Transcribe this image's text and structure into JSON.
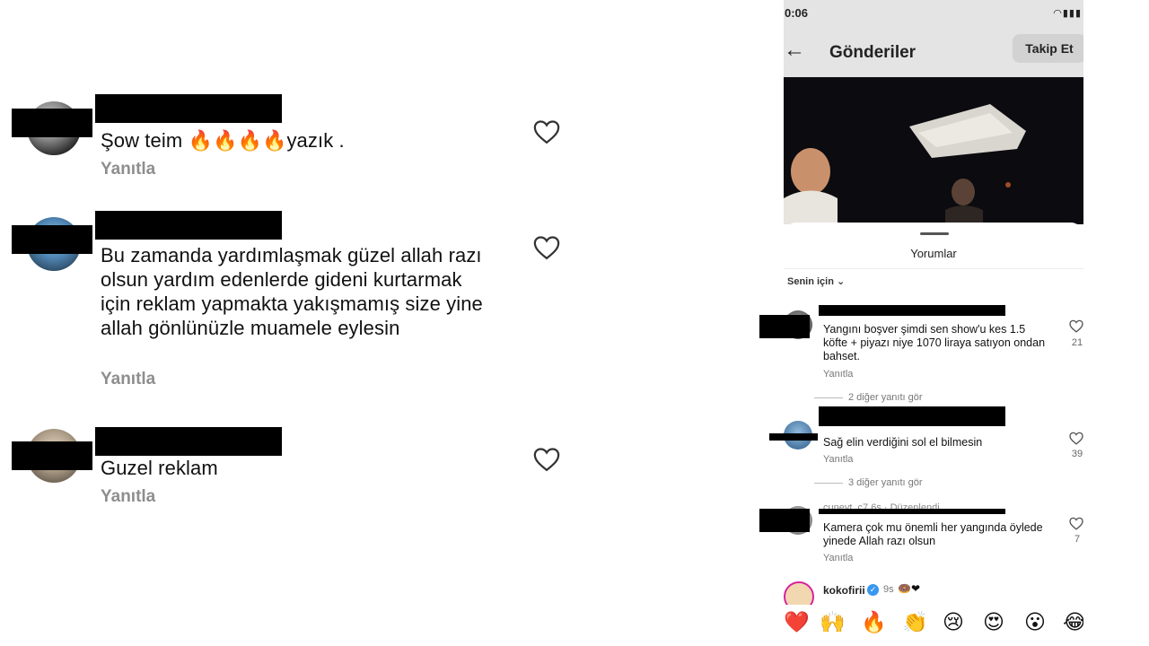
{
  "left_comments": [
    {
      "text": "Şow teim 🔥🔥🔥🔥yazık .",
      "reply": "Yanıtla"
    },
    {
      "text": "Bu zamanda yardımlaşmak güzel allah razı olsun yardım edenlerde gideni kurtarmak için reklam yapmakta yakışmamış size yine allah gönlünüzle muamele eylesin",
      "reply": "Yanıtla"
    },
    {
      "text": "Guzel reklam",
      "reply": "Yanıtla"
    }
  ],
  "phone": {
    "status_time": "0:06",
    "header": {
      "title": "Gönderiler",
      "follow_button": "Takip Et"
    },
    "sheet_title": "Yorumlar",
    "filter_label": "Senin için",
    "comments": [
      {
        "name_partial": "",
        "text": "Yangını boşver şimdi sen show'u kes 1.5 köfte + piyazı niye 1070 liraya satıyon ondan  bahset.",
        "reply": "Yanıtla",
        "likes": "21"
      },
      {
        "name_partial": "",
        "text": "Sağ elin verdiğini sol el bilmesin",
        "reply": "Yanıtla",
        "likes": "39"
      },
      {
        "name_partial": "cuneyt_c7  6s · Düzenlendi",
        "text": "Kamera çok mu önemli her yangında öylede yinede Allah razı olsun",
        "reply": "Yanıtla",
        "likes": "7"
      }
    ],
    "more_replies": [
      "2 diğer yanıtı gör",
      "3 diğer yanıtı gör"
    ],
    "last_comment": {
      "name": "kokofirii",
      "time": "9s",
      "emoji": "🍩❤"
    },
    "emoji_bar": [
      "❤️",
      "🙌",
      "🔥",
      "👏",
      "😢",
      "😍",
      "😮",
      "😂"
    ]
  },
  "colors": {
    "reply_gray": "#8e8e8e",
    "verified_blue": "#3897f0"
  },
  "icons": [
    "heart-outline-icon",
    "back-arrow-icon",
    "chevron-down-icon",
    "wifi-icon",
    "signal-icon",
    "battery-icon",
    "verified-badge-icon"
  ]
}
